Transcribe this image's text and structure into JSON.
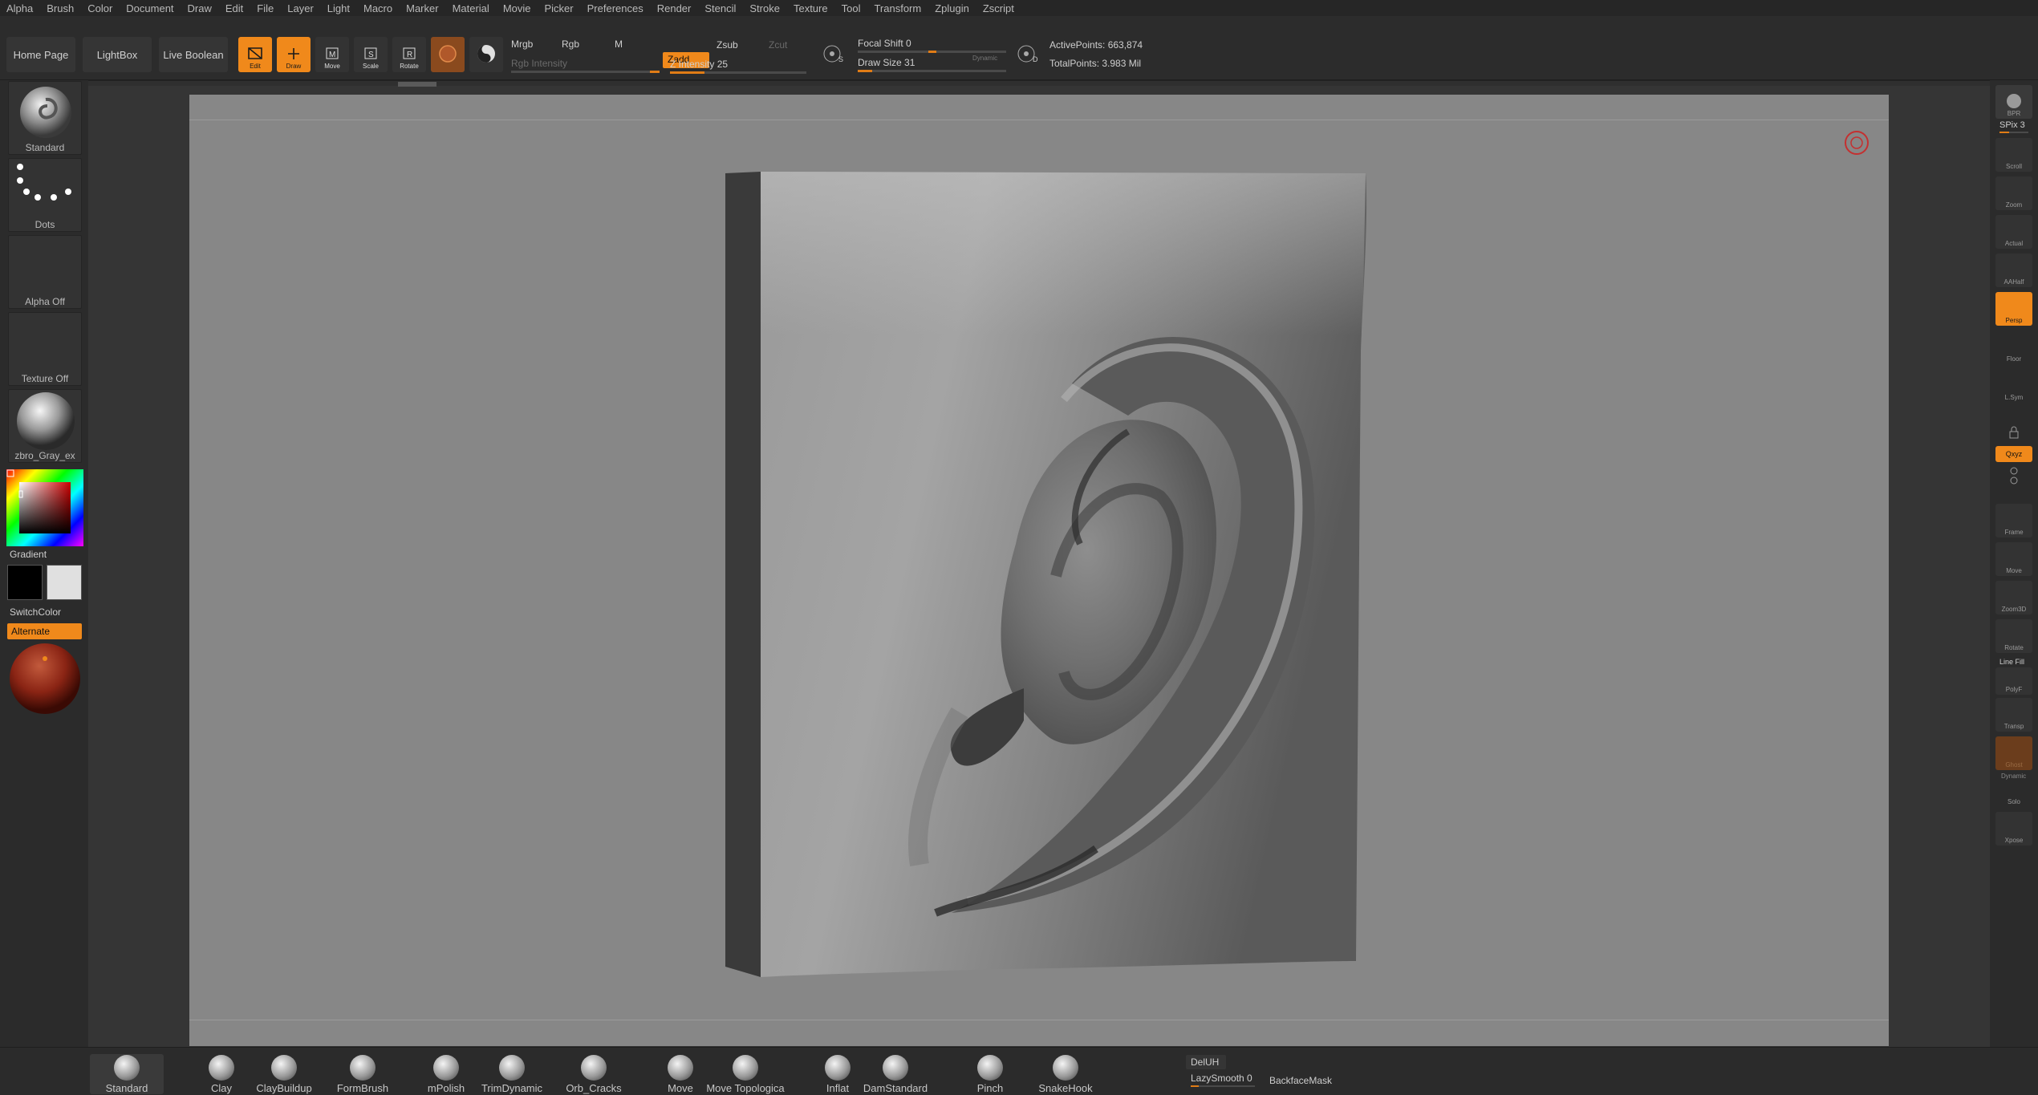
{
  "menu": [
    "Alpha",
    "Brush",
    "Color",
    "Document",
    "Draw",
    "Edit",
    "File",
    "Layer",
    "Light",
    "Macro",
    "Marker",
    "Material",
    "Movie",
    "Picker",
    "Preferences",
    "Render",
    "Stencil",
    "Stroke",
    "Texture",
    "Tool",
    "Transform",
    "Zplugin",
    "Zscript"
  ],
  "top": {
    "home_page": "Home Page",
    "lightbox": "LightBox",
    "live_boolean": "Live Boolean",
    "tools": {
      "edit": "Edit",
      "draw": "Draw",
      "move": "Move",
      "scale": "Scale",
      "rotate": "Rotate"
    },
    "mrgb": "Mrgb",
    "rgb": "Rgb",
    "m": "M",
    "rgb_intensity": "Rgb Intensity",
    "zadd": "Zadd",
    "zsub": "Zsub",
    "zcut": "Zcut",
    "z_intensity": "Z Intensity 25",
    "z_intensity_value": 25,
    "focal_shift": "Focal Shift 0",
    "focal_shift_value": 0,
    "draw_size": "Draw Size 31",
    "draw_size_value": 31,
    "dynamic": "Dynamic",
    "active_points": "ActivePoints: 663,874",
    "total_points": "TotalPoints: 3.983 Mil"
  },
  "left": {
    "brush": "Standard",
    "stroke": "Dots",
    "alpha": "Alpha Off",
    "texture": "Texture Off",
    "material": "zbro_Gray_ex",
    "gradient": "Gradient",
    "switch_color": "SwitchColor",
    "alternate": "Alternate",
    "main_color": "#000000",
    "secondary_color": "#e0e0e0"
  },
  "right": {
    "bpr": "BPR",
    "spix": "SPix 3",
    "scroll": "Scroll",
    "zoom": "Zoom",
    "actual": "Actual",
    "aahalf": "AAHalf",
    "persp": "Persp",
    "floor": "Floor",
    "lsym": "L.Sym",
    "lock": "",
    "xyz": "Qxyz",
    "frame": "Frame",
    "move": "Move",
    "zoom3d": "Zoom3D",
    "rotate": "Rotate",
    "line_fill": "Line Fill",
    "polyf": "PolyF",
    "transp": "Transp",
    "ghost": "Ghost",
    "dynamic": "Dynamic",
    "solo": "Solo",
    "xpose": "Xpose"
  },
  "bottom": {
    "brushes": [
      "Standard",
      "Clay",
      "ClayBuildup",
      "FormBrush",
      "mPolish",
      "TrimDynamic",
      "Orb_Cracks",
      "Move",
      "Move Topologica",
      "Inflat",
      "DamStandard",
      "Pinch",
      "SnakeHook"
    ],
    "delh": "DelUH",
    "lazy_smooth": "LazySmooth 0",
    "backface_mask": "BackfaceMask"
  },
  "colors": {
    "accent": "#f0891b",
    "bg": "#2b2b2b",
    "canvas": "#878787"
  }
}
